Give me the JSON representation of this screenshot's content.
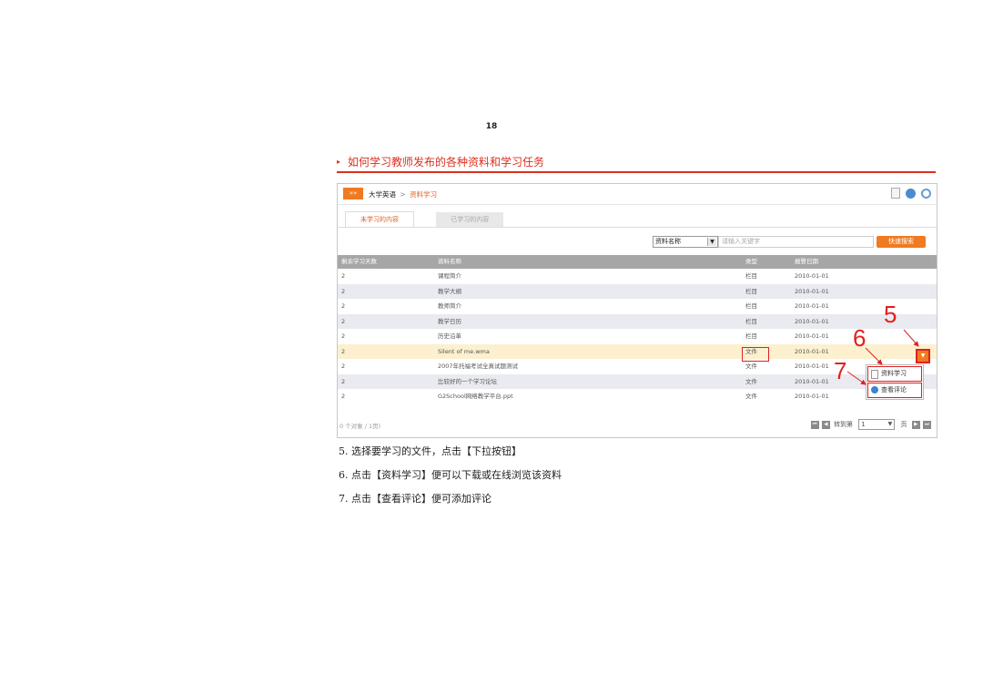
{
  "page": {
    "number": "18"
  },
  "section": {
    "bullet": "▸",
    "title": "如何学习教师发布的各种资料和学习任务"
  },
  "app": {
    "home_tag": "»»",
    "breadcrumb": {
      "course": "大学英语",
      "separator": ">",
      "current": "资料学习"
    },
    "tools": [
      "document-icon",
      "globe-icon",
      "search-icon"
    ],
    "tabs": [
      {
        "label": "未学习的内容",
        "active": true
      },
      {
        "label": "已学习的内容",
        "active": false
      }
    ],
    "search": {
      "field_selected": "资料名称",
      "placeholder": "请输入关键字",
      "button_label": "快速搜索"
    },
    "table": {
      "headers": [
        "剩余学习天数",
        "资料名称",
        "类型",
        "报警日期"
      ],
      "rows": [
        {
          "days": "2",
          "name": "课程简介",
          "type": "栏目",
          "date": "2010-01-01"
        },
        {
          "days": "2",
          "name": "教学大纲",
          "type": "栏目",
          "date": "2010-01-01"
        },
        {
          "days": "2",
          "name": "教师简介",
          "type": "栏目",
          "date": "2010-01-01"
        },
        {
          "days": "2",
          "name": "教学日历",
          "type": "栏目",
          "date": "2010-01-01"
        },
        {
          "days": "2",
          "name": "历史沿革",
          "type": "栏目",
          "date": "2010-01-01"
        },
        {
          "days": "2",
          "name": "Silent of me.wma",
          "type": "文件",
          "date": "2010-01-01"
        },
        {
          "days": "2",
          "name": "2007年托福考试全真试题测试",
          "type": "文件",
          "date": "2010-01-01"
        },
        {
          "days": "2",
          "name": "比较好的一个学习论坛",
          "type": "文件",
          "date": "2010-01-01"
        },
        {
          "days": "2",
          "name": "G2School网络教学平台.ppt",
          "type": "文件",
          "date": "2010-01-01"
        }
      ]
    },
    "footer": {
      "count": "0 个对象 / 1页)"
    },
    "pager": {
      "first": "⏮",
      "prev": "◀",
      "goto_label": "转到第",
      "page_value": "1",
      "page_unit": "页",
      "next": "▶",
      "last": "⏭"
    },
    "dropdown": {
      "symbol": "▼",
      "items": [
        "资料学习",
        "查看评论"
      ]
    },
    "callouts": [
      "5",
      "6",
      "7"
    ]
  },
  "steps": [
    "5. 选择要学习的文件，点击【下拉按钮】",
    "6. 点击【资料学习】便可以下载或在线浏览该资料",
    "7. 点击【查看评论】便可添加评论"
  ]
}
